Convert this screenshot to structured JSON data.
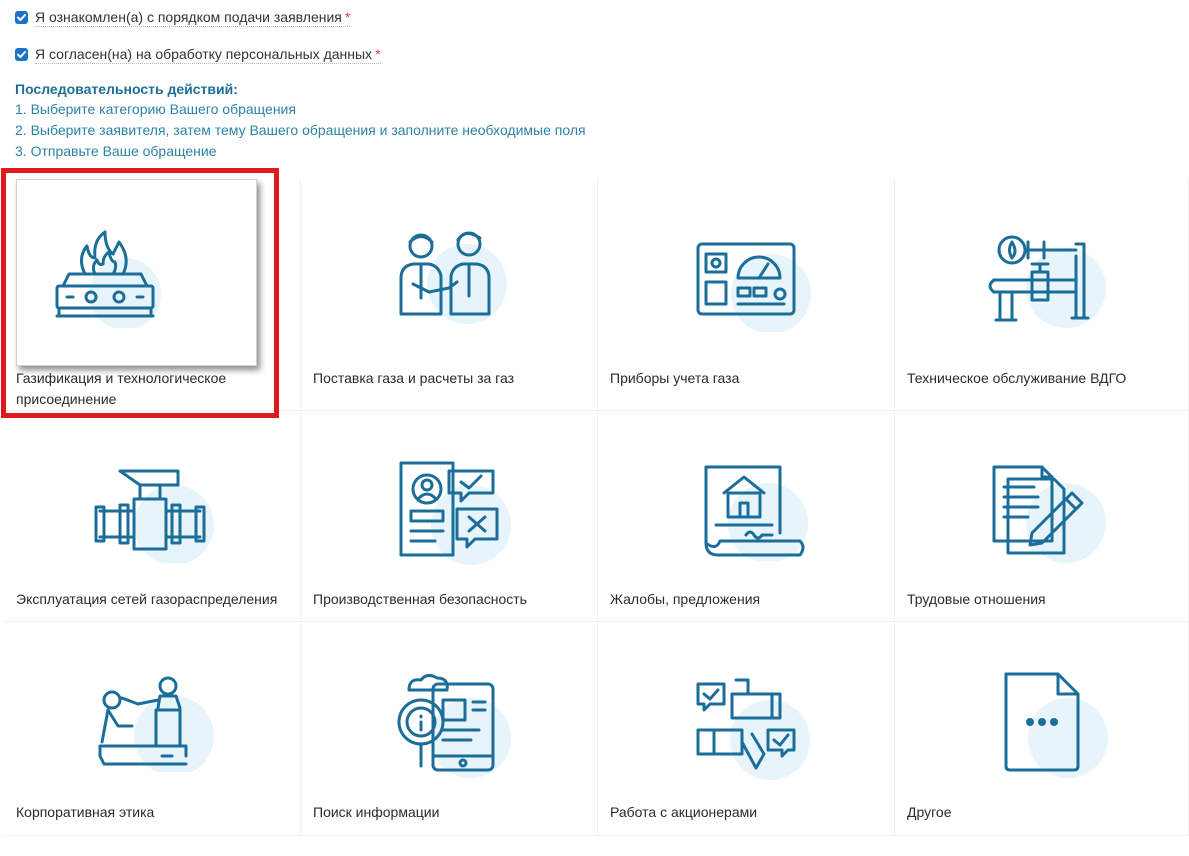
{
  "consents": [
    {
      "label": "Я ознакомлен(а) с порядком подачи заявления",
      "required_mark": "*"
    },
    {
      "label": "Я согласен(на) на обработку персональных данных",
      "required_mark": "*"
    }
  ],
  "steps": {
    "title": "Последовательность действий:",
    "items": [
      "1. Выберите категорию Вашего обращения",
      "2. Выберите заявителя, затем тему Вашего обращения и заполните необходимые поля",
      "3. Отправьте Ваше обращение"
    ]
  },
  "categories": [
    {
      "label_1": "Газификация и технологическое",
      "label_2": "присоединение",
      "icon": "gas-stove-icon",
      "selected": true
    },
    {
      "label_1": "Поставка газа и расчеты за газ",
      "icon": "business-handshake-icon"
    },
    {
      "label_1": "Приборы учета газа",
      "icon": "gas-meter-panel-icon"
    },
    {
      "label_1": "Техническое обслуживание ВДГО",
      "icon": "gas-pipe-valve-icon"
    },
    {
      "label_1": "Эксплуатация сетей газораспределения",
      "icon": "pipeline-valve-icon"
    },
    {
      "label_1": "Производственная безопасность",
      "icon": "safety-document-check-icon"
    },
    {
      "label_1": "Жалобы, предложения",
      "icon": "house-document-icon"
    },
    {
      "label_1": "Трудовые отношения",
      "icon": "documents-pen-icon"
    },
    {
      "label_1": "Корпоративная этика",
      "icon": "helping-hand-icon"
    },
    {
      "label_1": "Поиск информации",
      "icon": "info-search-icon"
    },
    {
      "label_1": "Работа с акционерами",
      "icon": "shareholders-hands-icon"
    },
    {
      "label_1": "Другое",
      "icon": "other-document-icon"
    }
  ],
  "colors": {
    "accent": "#1a73c8",
    "icon_stroke": "#1c6e9a",
    "icon_blob": "#e7f4fb",
    "steps_title": "#1f6e96",
    "steps_text": "#2b84a8",
    "required": "#e53935",
    "selection_frame": "#e0191c"
  }
}
